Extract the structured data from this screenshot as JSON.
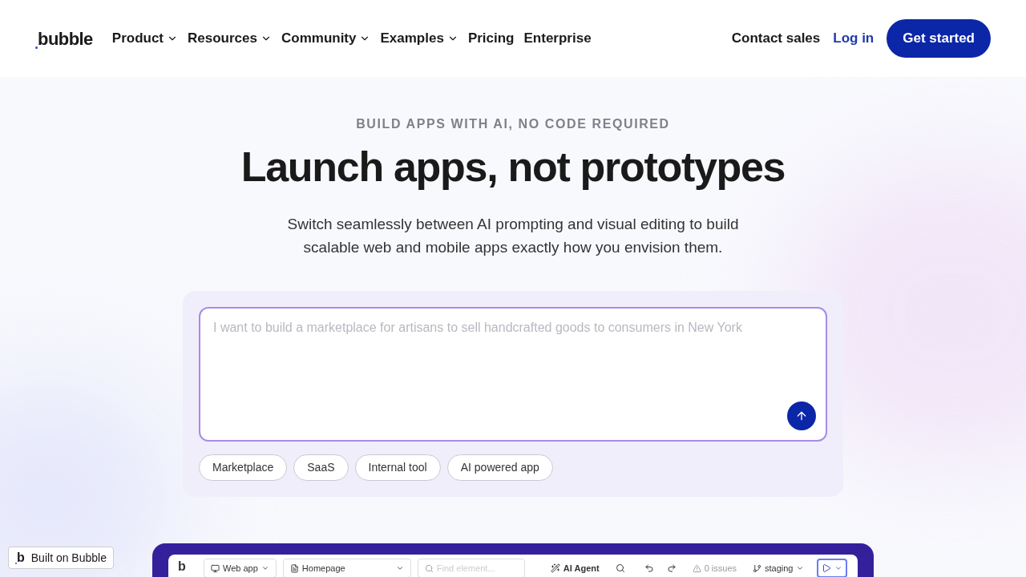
{
  "header": {
    "logo": "bubble",
    "nav": [
      {
        "label": "Product",
        "dropdown": true
      },
      {
        "label": "Resources",
        "dropdown": true
      },
      {
        "label": "Community",
        "dropdown": true
      },
      {
        "label": "Examples",
        "dropdown": true
      },
      {
        "label": "Pricing",
        "dropdown": false
      },
      {
        "label": "Enterprise",
        "dropdown": false
      }
    ],
    "contact": "Contact sales",
    "login": "Log in",
    "cta": "Get started"
  },
  "hero": {
    "eyebrow": "BUILD APPS WITH AI, NO CODE REQUIRED",
    "title": "Launch apps, not prototypes",
    "subtitle": "Switch seamlessly between AI prompting and visual editing to build scalable web and mobile apps exactly how you envision them."
  },
  "prompt": {
    "placeholder": "I want to build a marketplace for artisans to sell handcrafted goods to consumers in New York",
    "chips": [
      "Marketplace",
      "SaaS",
      "Internal tool",
      "AI powered app"
    ]
  },
  "badge": {
    "mark": "b",
    "label": "Built on Bubble"
  },
  "editor": {
    "logo": "b",
    "app_type": "Web app",
    "page": "Homepage",
    "search_placeholder": "Find element...",
    "agent": "AI Agent",
    "issues": "0 issues",
    "branch": "staging"
  }
}
